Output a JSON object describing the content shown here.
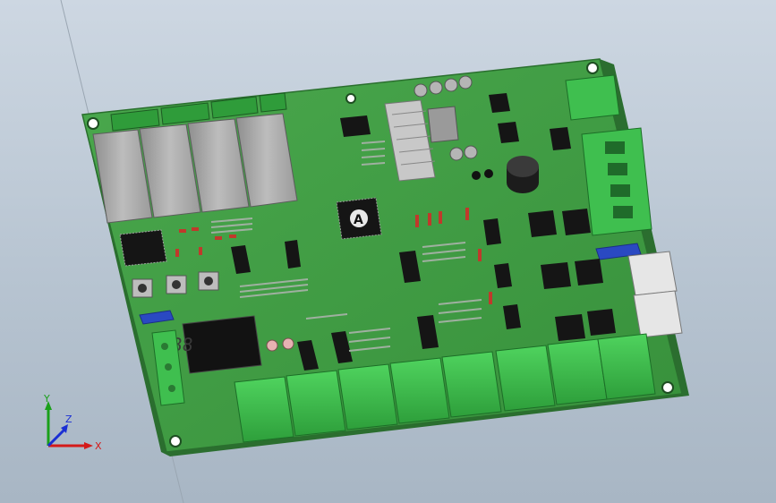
{
  "viewport": {
    "background_top": "#cdd7e2",
    "background_bottom": "#a8b6c4"
  },
  "board": {
    "pcb_color": "#3f9a43",
    "pcb_edge_color": "#2a6f2e",
    "connector_color": "#3fbf4f",
    "chip_color": "#161616",
    "relay_color": "#a9a9a9",
    "display_digits": "888",
    "chip_label": "A"
  },
  "triad": {
    "x_label": "X",
    "y_label": "Y",
    "z_label": "Z",
    "x_color": "#d41a1a",
    "y_color": "#1aa01a",
    "z_color": "#1a2fd4"
  }
}
